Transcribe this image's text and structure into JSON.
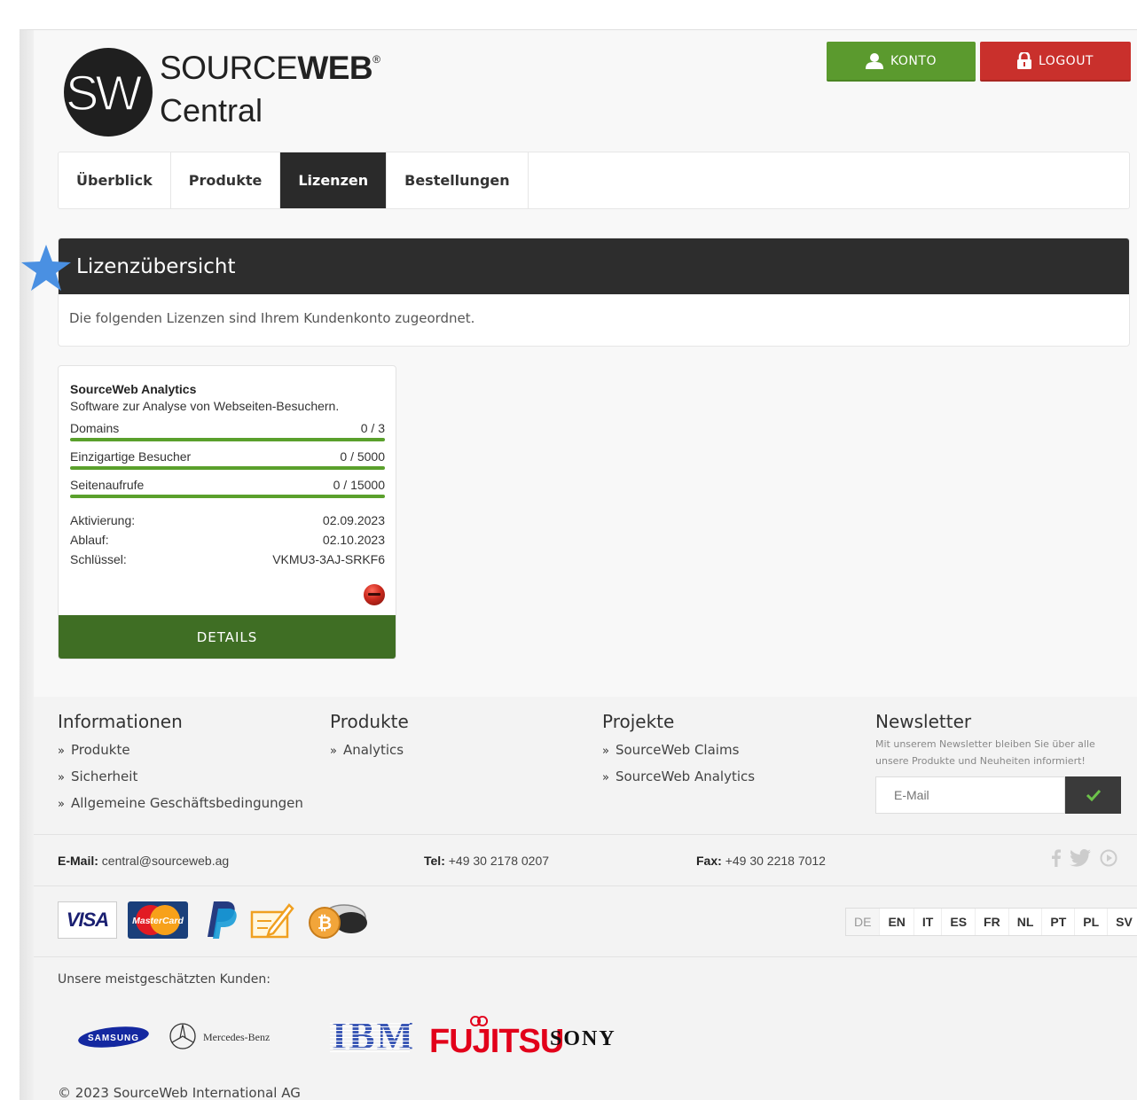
{
  "logo": {
    "brand_part1": "SOURCE",
    "brand_part2": "WEB",
    "reg": "®",
    "subtitle": "Central",
    "mark": "SW"
  },
  "header": {
    "account_label": "KONTO",
    "logout_label": "LOGOUT"
  },
  "nav": {
    "items": [
      {
        "label": "Überblick",
        "active": false
      },
      {
        "label": "Produkte",
        "active": false
      },
      {
        "label": "Lizenzen",
        "active": true
      },
      {
        "label": "Bestellungen",
        "active": false
      }
    ]
  },
  "panel": {
    "title": "Lizenzübersicht",
    "description": "Die folgenden Lizenzen sind Ihrem Kundenkonto zugeordnet."
  },
  "license": {
    "name": "SourceWeb Analytics",
    "description": "Software zur Analyse von Webseiten-Besuchern.",
    "stats": [
      {
        "label": "Domains",
        "value": "0 / 3"
      },
      {
        "label": "Einzigartige Besucher",
        "value": "0 / 5000"
      },
      {
        "label": "Seitenaufrufe",
        "value": "0 / 15000"
      }
    ],
    "meta": [
      {
        "label": "Aktivierung:",
        "value": "02.09.2023"
      },
      {
        "label": "Ablauf:",
        "value": "02.10.2023"
      },
      {
        "label": "Schlüssel:",
        "value": "VKMU3-3AJ-SRKF6"
      }
    ],
    "details_label": "DETAILS"
  },
  "footer": {
    "info": {
      "title": "Informationen",
      "links": [
        "Produkte",
        "Sicherheit",
        "Allgemeine Geschäftsbedingungen"
      ]
    },
    "products": {
      "title": "Produkte",
      "links": [
        "Analytics"
      ]
    },
    "projects": {
      "title": "Projekte",
      "links": [
        "SourceWeb Claims",
        "SourceWeb Analytics"
      ]
    },
    "newsletter": {
      "title": "Newsletter",
      "text": "Mit unserem Newsletter bleiben Sie über alle unsere Produkte und Neuheiten informiert!",
      "placeholder": "E-Mail"
    },
    "contact": {
      "email_label": "E-Mail:",
      "email": "central@sourceweb.ag",
      "tel_label": "Tel:",
      "tel": "+49 30 2178 0207",
      "fax_label": "Fax:",
      "fax": "+49 30 2218 7012"
    },
    "payments": {
      "visa": "VISA",
      "mastercard": "MasterCard"
    },
    "languages": [
      "DE",
      "EN",
      "IT",
      "ES",
      "FR",
      "NL",
      "PT",
      "PL",
      "SV"
    ],
    "active_language": "DE",
    "customers_title": "Unsere meistgeschätzten Kunden:",
    "customers": [
      "SAMSUNG",
      "Mercedes-Benz",
      "IBM",
      "FUJITSU",
      "SONY"
    ],
    "copyright": "© 2023 SourceWeb International AG"
  },
  "colors": {
    "green": "#5b9a2e",
    "red": "#c9302c",
    "dark": "#2d2d2d",
    "details_green": "#3f6e24"
  }
}
